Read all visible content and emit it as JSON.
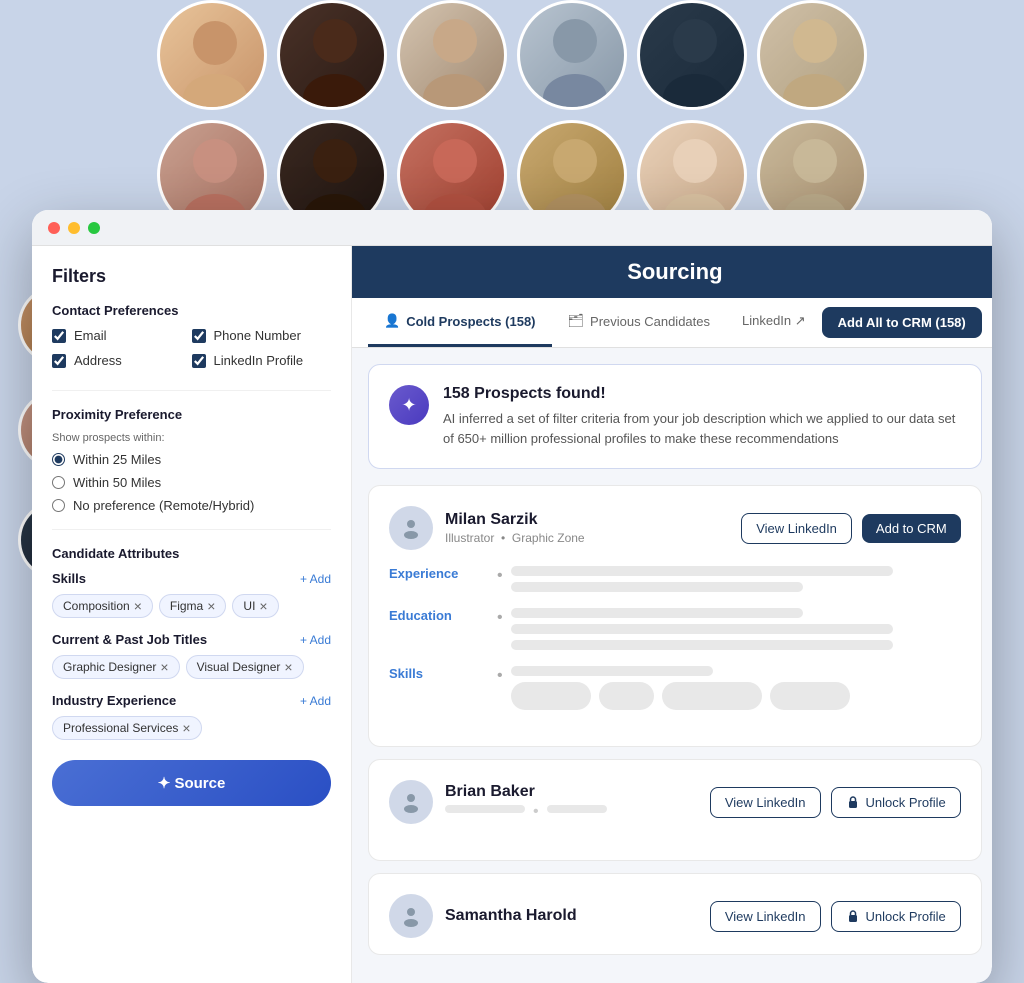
{
  "app": {
    "title": "Sourcing",
    "window_dots": [
      "red",
      "yellow",
      "green"
    ]
  },
  "photos": {
    "row1": [
      "av1",
      "av2",
      "av3",
      "av4",
      "av5",
      "av6"
    ],
    "row2": [
      "av7",
      "av8",
      "av9",
      "av10",
      "av11",
      "av12"
    ]
  },
  "sidebar": {
    "title": "Filters",
    "contact_prefs": {
      "title": "Contact Preferences",
      "items": [
        {
          "label": "Email",
          "checked": true
        },
        {
          "label": "Phone Number",
          "checked": true
        },
        {
          "label": "Address",
          "checked": true
        },
        {
          "label": "LinkedIn Profile",
          "checked": true
        }
      ]
    },
    "proximity": {
      "title": "Proximity Preference",
      "subtitle": "Show prospects within:",
      "options": [
        {
          "label": "Within 25 Miles",
          "selected": true
        },
        {
          "label": "Within 50 Miles",
          "selected": false
        },
        {
          "label": "No preference (Remote/Hybrid)",
          "selected": false
        }
      ]
    },
    "candidate_attrs": {
      "title": "Candidate Attributes",
      "skills": {
        "label": "Skills",
        "add_label": "+ Add",
        "tags": [
          "Composition",
          "Figma",
          "UI"
        ]
      },
      "job_titles": {
        "label": "Current & Past Job Titles",
        "add_label": "+ Add",
        "tags": [
          "Graphic Designer",
          "Visual Designer"
        ]
      },
      "industry": {
        "label": "Industry Experience",
        "add_label": "+ Add",
        "tags": [
          "Professional Services"
        ]
      }
    },
    "source_btn": "✦ Source"
  },
  "main": {
    "tabs": [
      {
        "label": "Cold Prospects (158)",
        "icon": "👤",
        "active": true
      },
      {
        "label": "Previous Candidates",
        "icon": "🗂",
        "active": false
      },
      {
        "label": "LinkedIn ↗",
        "icon": "",
        "active": false
      }
    ],
    "add_all_btn": "Add All to CRM (158)",
    "banner": {
      "icon": "✦",
      "title": "158 Prospects found!",
      "description": "AI inferred a set of filter criteria from your job description which we applied to our data set of 650+ million professional profiles to make these recommendations"
    },
    "candidates": [
      {
        "name": "Milan Sarzik",
        "title": "Illustrator",
        "company": "Graphic Zone",
        "actions": [
          "View LinkedIn",
          "Add to CRM"
        ],
        "show_details": true
      },
      {
        "name": "Brian Baker",
        "title": "",
        "company": "",
        "actions": [
          "View LinkedIn",
          "Unlock Profile"
        ],
        "show_details": false,
        "lock": true
      },
      {
        "name": "Samantha Harold",
        "title": "",
        "company": "",
        "actions": [
          "View LinkedIn",
          "Unlock Profile"
        ],
        "show_details": false,
        "lock": true
      }
    ]
  }
}
